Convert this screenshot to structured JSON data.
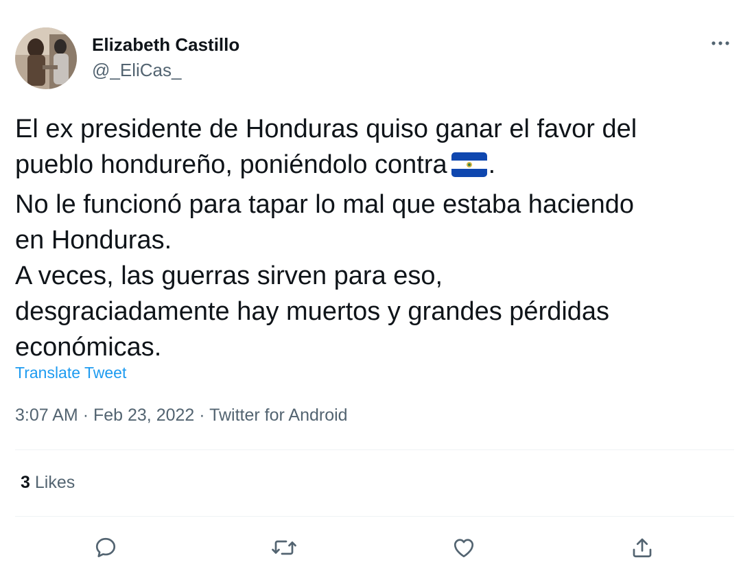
{
  "author": {
    "display_name": "Elizabeth Castillo",
    "handle": "@_EliCas_"
  },
  "tweet": {
    "lines": [
      "El ex presidente de Honduras quiso ganar el favor del",
      "pueblo hondureño, poniéndolo contra",
      ".",
      "No le funcionó para tapar lo mal que estaba haciendo",
      "en Honduras.",
      "A veces, las guerras sirven para eso,",
      "desgraciadamente hay muertos y grandes pérdidas",
      "económicas."
    ],
    "inline_emoji": "el-salvador-flag",
    "translate_label": "Translate Tweet",
    "time": "3:07 AM",
    "date": "Feb 23, 2022",
    "source": "Twitter for Android",
    "separator": "·"
  },
  "stats": {
    "likes_count": "3",
    "likes_label": "Likes"
  },
  "actions": [
    "reply-icon",
    "retweet-icon",
    "like-icon",
    "share-icon"
  ],
  "colors": {
    "text": "#0f1419",
    "secondary": "#536471",
    "link": "#1d9bf0",
    "divider": "#eff3f4",
    "flag_blue": "#0f47af"
  }
}
